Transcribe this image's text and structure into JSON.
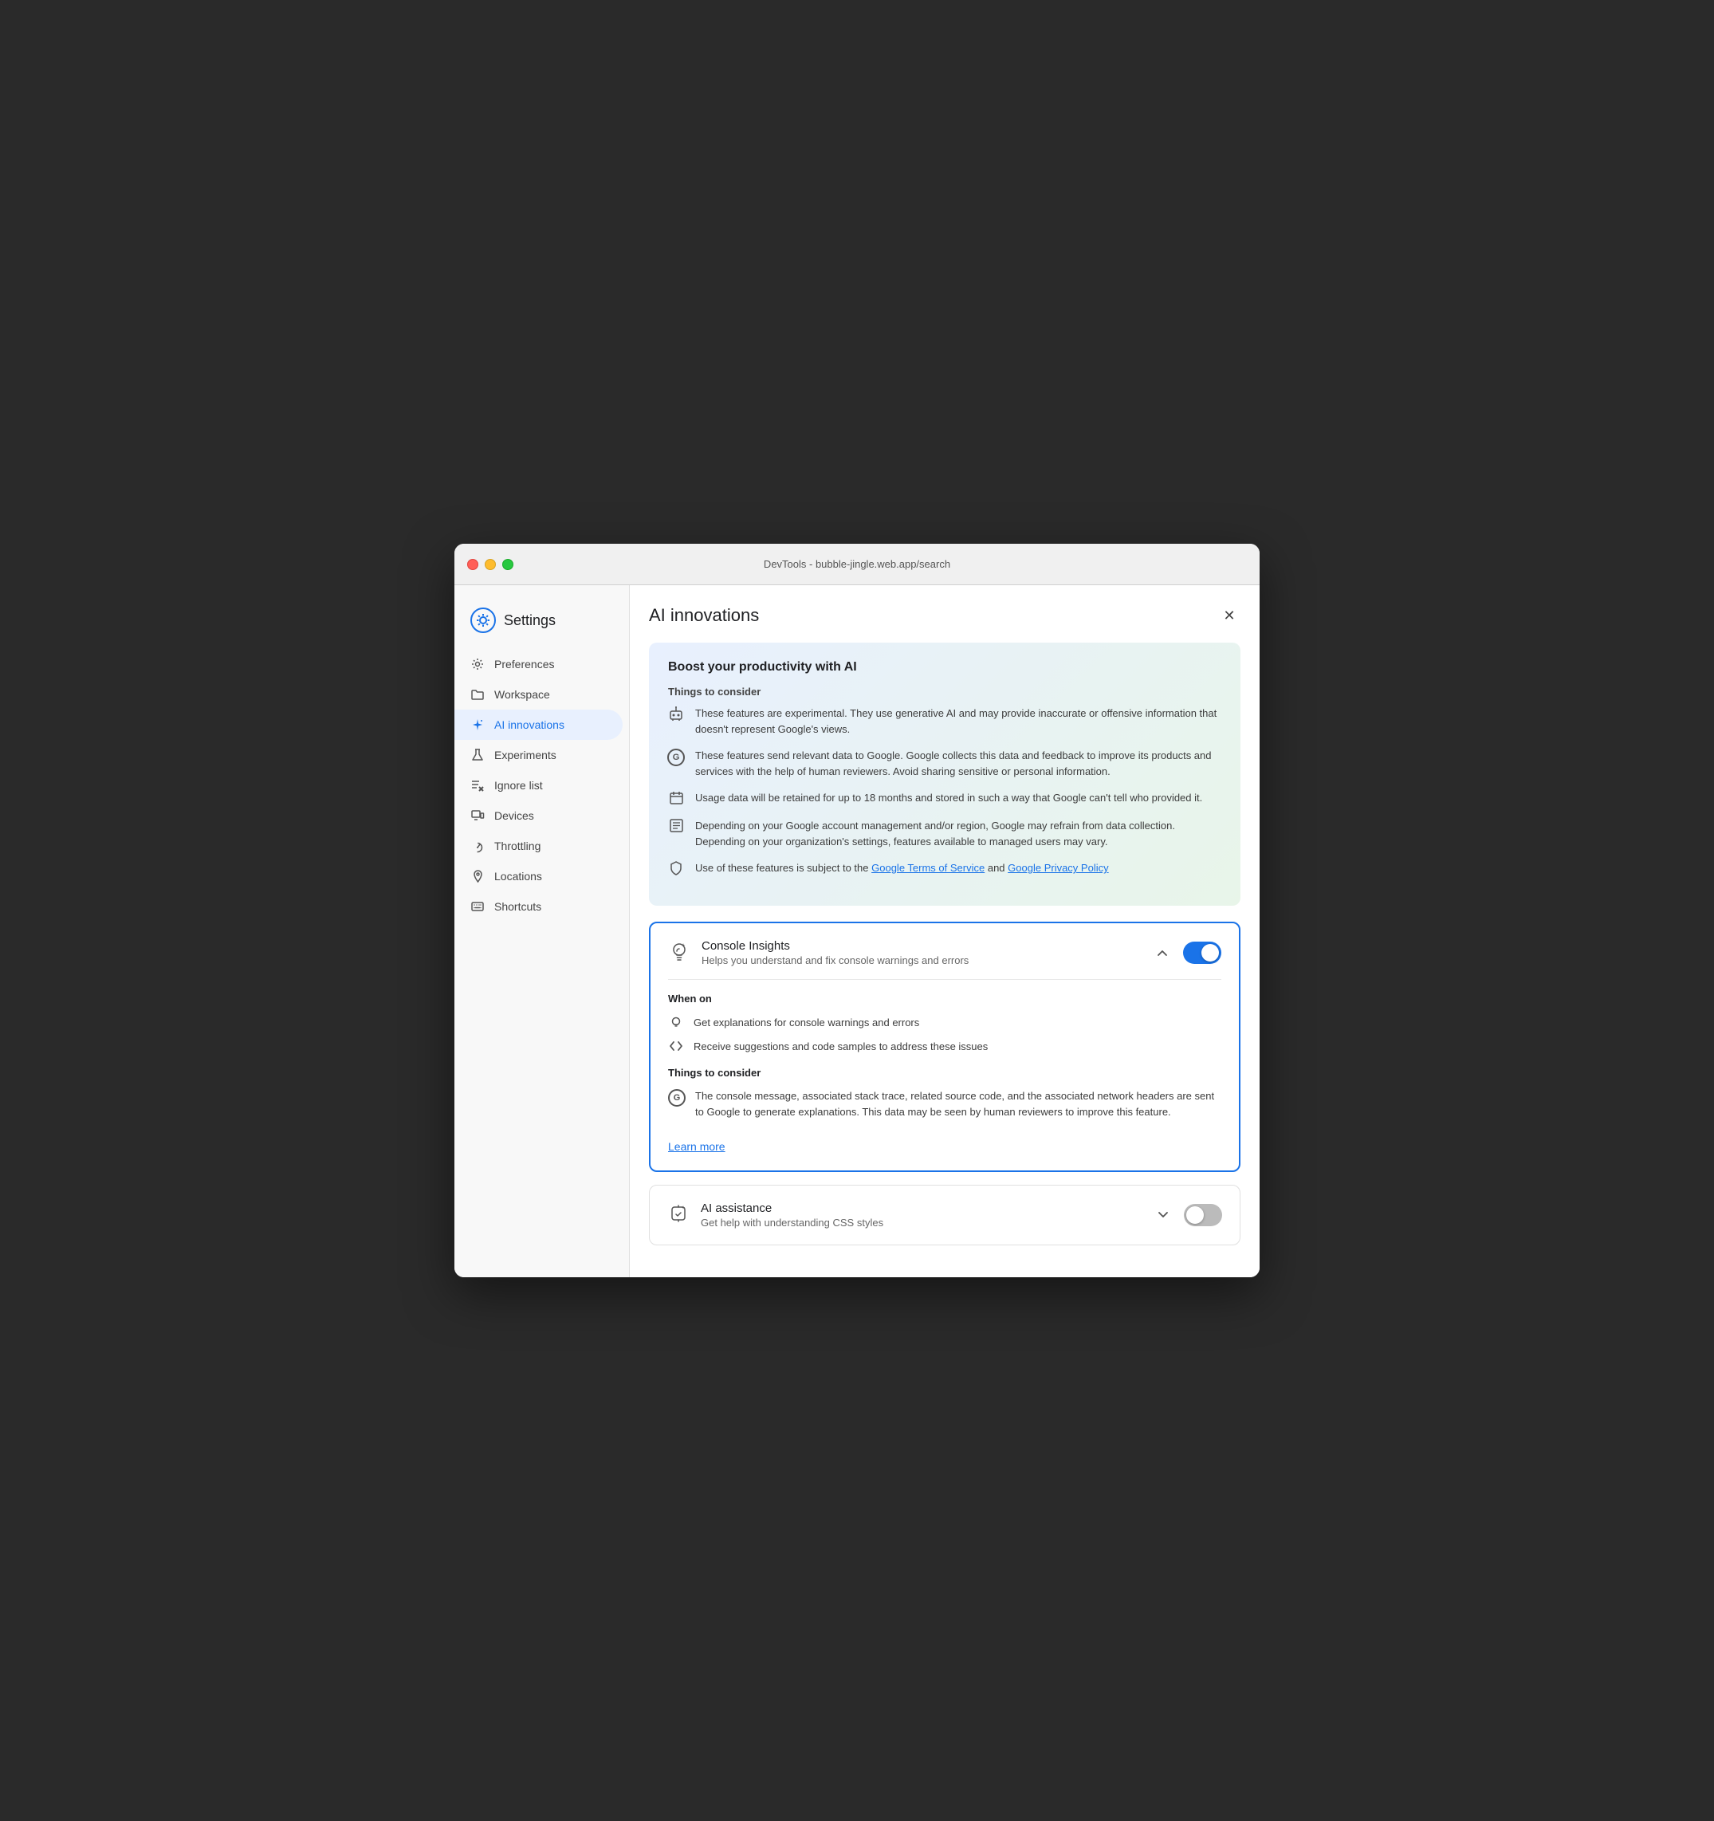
{
  "window": {
    "title": "DevTools - bubble-jingle.web.app/search"
  },
  "sidebar": {
    "header": {
      "title": "Settings"
    },
    "items": [
      {
        "id": "preferences",
        "label": "Preferences",
        "icon": "gear"
      },
      {
        "id": "workspace",
        "label": "Workspace",
        "icon": "folder"
      },
      {
        "id": "ai-innovations",
        "label": "AI innovations",
        "icon": "sparkle",
        "active": true
      },
      {
        "id": "experiments",
        "label": "Experiments",
        "icon": "flask"
      },
      {
        "id": "ignore-list",
        "label": "Ignore list",
        "icon": "ignore"
      },
      {
        "id": "devices",
        "label": "Devices",
        "icon": "devices"
      },
      {
        "id": "throttling",
        "label": "Throttling",
        "icon": "throttle"
      },
      {
        "id": "locations",
        "label": "Locations",
        "icon": "location"
      },
      {
        "id": "shortcuts",
        "label": "Shortcuts",
        "icon": "keyboard"
      }
    ]
  },
  "content": {
    "title": "AI innovations",
    "info_card": {
      "title": "Boost your productivity with AI",
      "subtitle": "Things to consider",
      "items": [
        {
          "icon": "robot",
          "text": "These features are experimental. They use generative AI and may provide inaccurate or offensive information that doesn't represent Google's views."
        },
        {
          "icon": "google",
          "text": "These features send relevant data to Google. Google collects this data and feedback to improve its products and services with the help of human reviewers. Avoid sharing sensitive or personal information."
        },
        {
          "icon": "calendar",
          "text": "Usage data will be retained for up to 18 months and stored in such a way that Google can't tell who provided it."
        },
        {
          "icon": "list",
          "text": "Depending on your Google account management and/or region, Google may refrain from data collection. Depending on your organization's settings, features available to managed users may vary."
        },
        {
          "icon": "shield",
          "text_before": "Use of these features is subject to the ",
          "link1_text": "Google Terms of Service",
          "text_middle": " and ",
          "link2_text": "Google Privacy Policy",
          "text_after": ""
        }
      ]
    },
    "features": [
      {
        "id": "console-insights",
        "icon": "bulb",
        "title": "Console Insights",
        "description": "Helps you understand and fix console warnings and errors",
        "enabled": true,
        "expanded": true,
        "when_on": {
          "title": "When on",
          "items": [
            {
              "icon": "bulb",
              "text": "Get explanations for console warnings and errors"
            },
            {
              "icon": "code",
              "text": "Receive suggestions and code samples to address these issues"
            }
          ]
        },
        "considerations": {
          "title": "Things to consider",
          "items": [
            {
              "icon": "google",
              "text": "The console message, associated stack trace, related source code, and the associated network headers are sent to Google to generate explanations. This data may be seen by human reviewers to improve this feature."
            }
          ]
        },
        "learn_more_text": "Learn more"
      },
      {
        "id": "ai-assistance",
        "icon": "ai-assist",
        "title": "AI assistance",
        "description": "Get help with understanding CSS styles",
        "enabled": false,
        "expanded": false
      }
    ]
  }
}
